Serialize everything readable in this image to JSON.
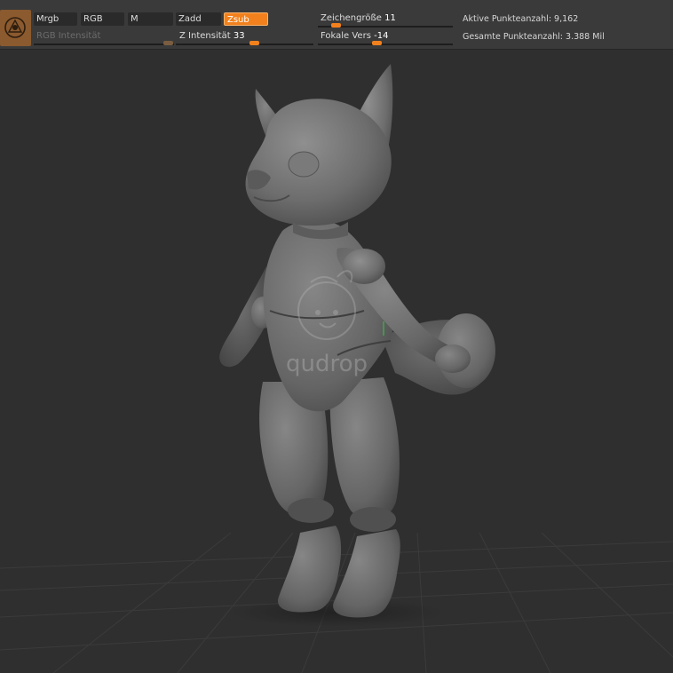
{
  "toolbar": {
    "toggles": [
      {
        "label": "Mrgb",
        "active": false
      },
      {
        "label": "RGB",
        "active": false
      },
      {
        "label": "M",
        "active": false
      },
      {
        "label": "Zadd",
        "active": false
      },
      {
        "label": "Zsub",
        "active": true
      }
    ],
    "rgb_intensity": {
      "label": "RGB Intensität",
      "enabled": false
    },
    "z_intensity": {
      "label": "Z Intensität",
      "value": "33"
    },
    "draw_size": {
      "label": "Zeichengröße",
      "value": "11"
    },
    "focal_shift": {
      "label": "Fokale Vers",
      "value": "-14"
    },
    "active_points": "Aktive Punkteanzahl: 9,162",
    "total_points": "Gesamte Punkteanzahl: 3.388 Mil"
  },
  "viewport": {
    "watermark": "qudrop"
  },
  "colors": {
    "accent": "#f2811d",
    "toolbar_bg": "#3a3a3a",
    "viewport_bg": "#2f2f2f",
    "brush_slot": "#8b5a2e"
  },
  "icons": [
    "brush-icon"
  ]
}
